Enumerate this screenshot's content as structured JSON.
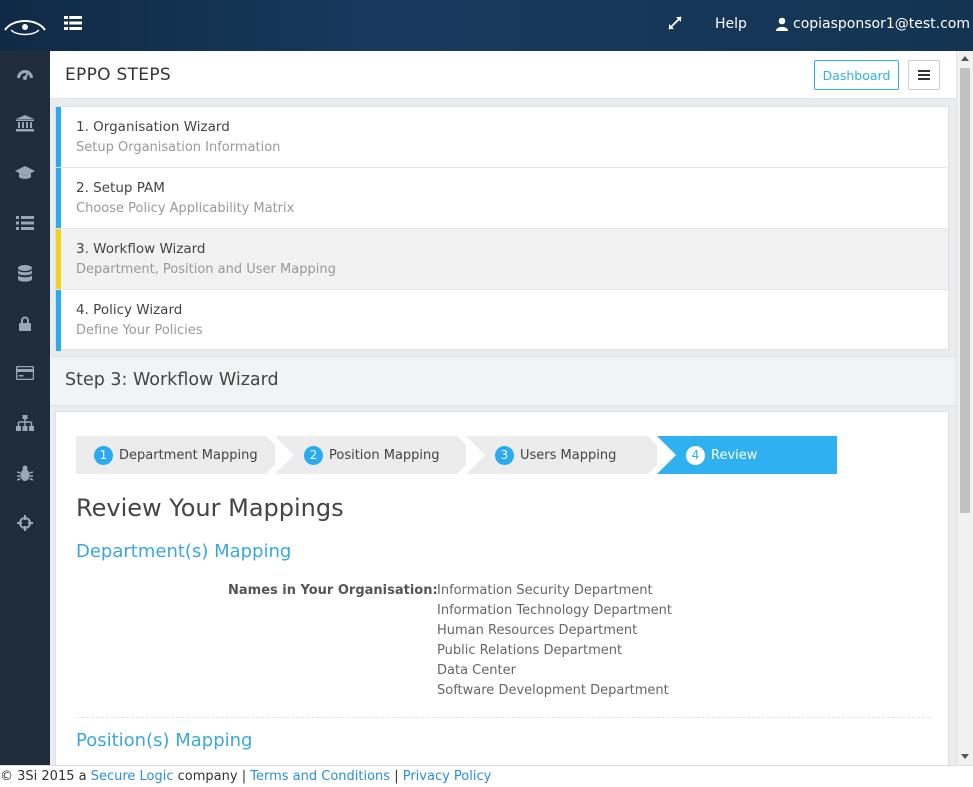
{
  "topbar": {
    "help_label": "Help",
    "user_email": "copiasponsor1@test.com"
  },
  "sidebar": {
    "items": [
      {
        "icon": "dashboard-icon"
      },
      {
        "icon": "bank-icon"
      },
      {
        "icon": "graduation-cap-icon"
      },
      {
        "icon": "list-icon"
      },
      {
        "icon": "database-icon"
      },
      {
        "icon": "lock-icon"
      },
      {
        "icon": "credit-card-icon"
      },
      {
        "icon": "sitemap-icon"
      },
      {
        "icon": "bug-icon"
      },
      {
        "icon": "crosshairs-icon"
      }
    ]
  },
  "page_header": {
    "title": "EPPO STEPS",
    "dashboard_label": "Dashboard"
  },
  "steps": [
    {
      "title": "1. Organisation Wizard",
      "subtitle": "Setup Organisation Information"
    },
    {
      "title": "2. Setup PAM",
      "subtitle": "Choose Policy Applicability Matrix"
    },
    {
      "title": "3. Workflow Wizard",
      "subtitle": "Department, Position and User Mapping"
    },
    {
      "title": "4. Policy Wizard",
      "subtitle": "Define Your Policies"
    }
  ],
  "section": {
    "title": "Step 3: Workflow Wizard"
  },
  "wizard": [
    {
      "num": "1",
      "label": "Department Mapping"
    },
    {
      "num": "2",
      "label": "Position Mapping"
    },
    {
      "num": "3",
      "label": "Users Mapping"
    },
    {
      "num": "4",
      "label": "Review"
    }
  ],
  "review": {
    "title": "Review Your Mappings",
    "dept_heading": "Department(s) Mapping",
    "names_label": "Names in Your Organisation:",
    "departments": [
      "Information Security Department",
      "Information Technology Department",
      "Human Resources Department",
      "Public Relations Department",
      "Data Center",
      "Software Development Department"
    ],
    "position_heading": "Position(s) Mapping"
  },
  "footer": {
    "prefix": "© 3Si 2015 a ",
    "company_link": "Secure Logic",
    "company_suffix": " company | ",
    "terms_link": "Terms and Conditions",
    "separator": " | ",
    "privacy_link": "Privacy Policy"
  },
  "colors": {
    "accent": "#2fb0f0",
    "active_step_bar": "#f5d11c",
    "sidebar_bg": "#1f2d3a",
    "topbar_bg": "#143452"
  }
}
